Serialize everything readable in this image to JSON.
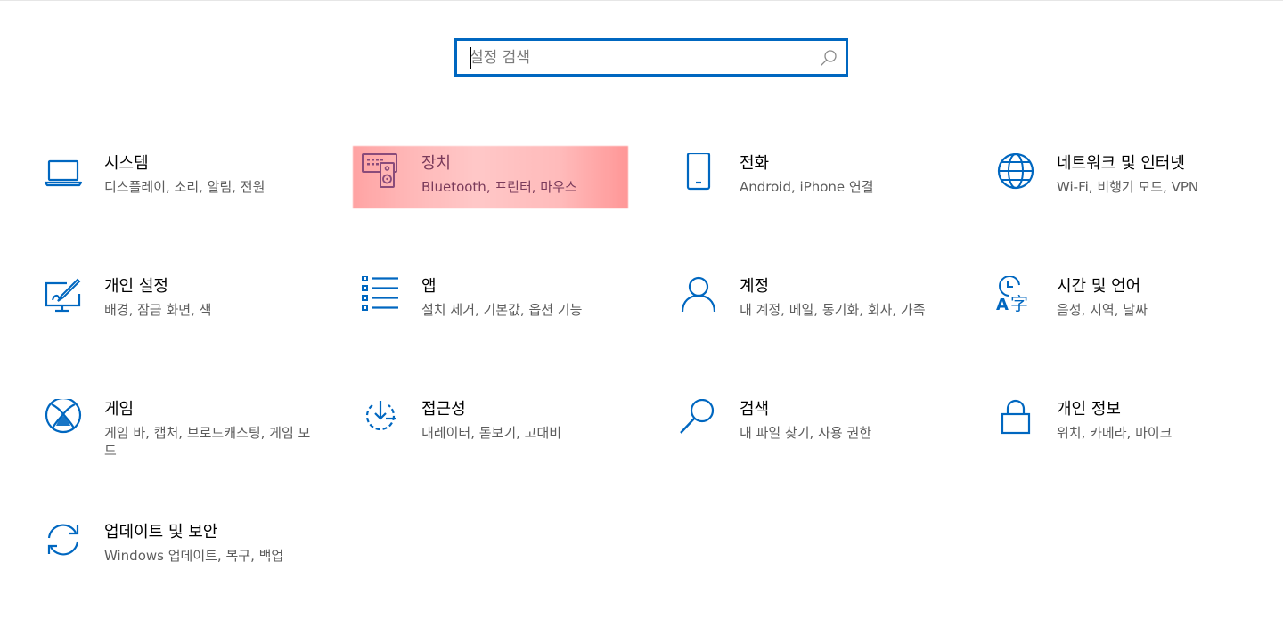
{
  "search": {
    "placeholder": "설정 검색"
  },
  "colors": {
    "accent": "#0067c0",
    "highlight": "#ff9a9a"
  },
  "tiles": [
    {
      "title": "시스템",
      "desc": "디스플레이, 소리, 알림, 전원",
      "icon": "laptop-icon"
    },
    {
      "title": "장치",
      "desc": "Bluetooth, 프린터, 마우스",
      "icon": "devices-icon"
    },
    {
      "title": "전화",
      "desc": "Android, iPhone 연결",
      "icon": "phone-icon"
    },
    {
      "title": "네트워크 및 인터넷",
      "desc": "Wi-Fi, 비행기 모드, VPN",
      "icon": "globe-icon"
    },
    {
      "title": "개인 설정",
      "desc": "배경, 잠금 화면, 색",
      "icon": "personalization-icon"
    },
    {
      "title": "앱",
      "desc": "설치 제거, 기본값, 옵션 기능",
      "icon": "apps-list-icon"
    },
    {
      "title": "계정",
      "desc": "내 계정, 메일, 동기화, 회사, 가족",
      "icon": "person-icon"
    },
    {
      "title": "시간 및 언어",
      "desc": "음성, 지역, 날짜",
      "icon": "time-language-icon"
    },
    {
      "title": "게임",
      "desc": "게임 바, 캡처, 브로드캐스팅, 게임 모드",
      "icon": "xbox-icon"
    },
    {
      "title": "접근성",
      "desc": "내레이터, 돋보기, 고대비",
      "icon": "ease-of-access-icon"
    },
    {
      "title": "검색",
      "desc": "내 파일 찾기, 사용 권한",
      "icon": "search-icon"
    },
    {
      "title": "개인 정보",
      "desc": "위치, 카메라, 마이크",
      "icon": "lock-icon"
    },
    {
      "title": "업데이트 및 보안",
      "desc": "Windows 업데이트, 복구, 백업",
      "icon": "sync-icon"
    }
  ]
}
